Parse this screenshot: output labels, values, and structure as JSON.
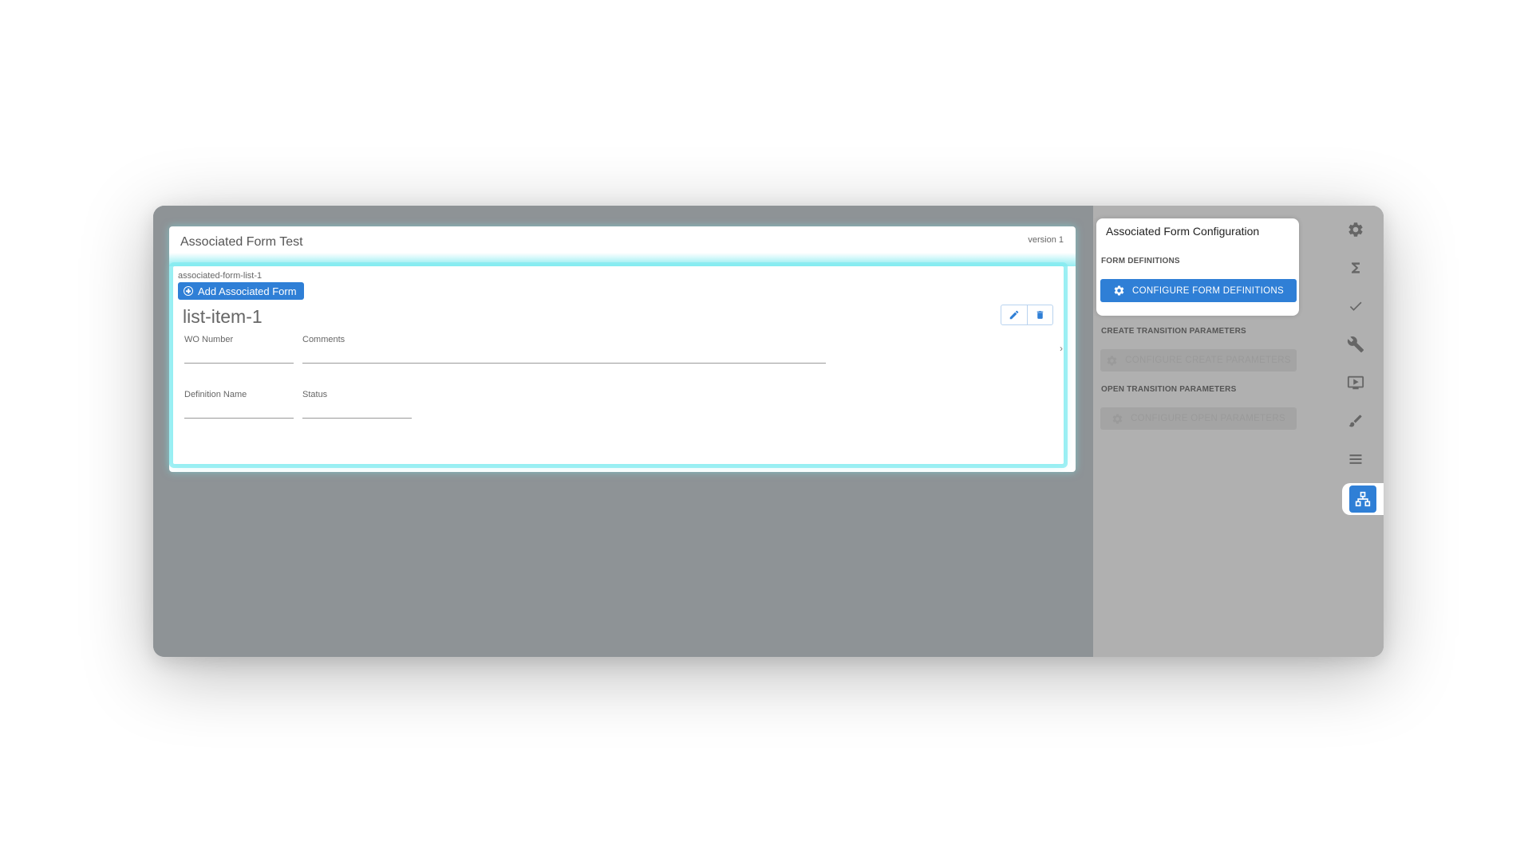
{
  "form": {
    "title": "Associated Form Test",
    "version": "version 1",
    "list": {
      "id": "associated-form-list-1",
      "add_button": "Add Associated Form",
      "item": {
        "title": "list-item-1",
        "fields": [
          {
            "label": "WO Number",
            "value": ""
          },
          {
            "label": "Comments",
            "value": ""
          },
          {
            "label": "Definition Name",
            "value": ""
          },
          {
            "label": "Status",
            "value": ""
          }
        ]
      }
    }
  },
  "config": {
    "title": "Associated Form Configuration",
    "form_definitions_label": "FORM DEFINITIONS",
    "configure_form_definitions": "CONFIGURE FORM DEFINITIONS",
    "create_transition_label": "CREATE TRANSITION PARAMETERS",
    "configure_create": "CONFIGURE CREATE PARAMETERS",
    "open_transition_label": "OPEN TRANSITION PARAMETERS",
    "configure_open": "CONFIGURE OPEN PARAMETERS"
  },
  "toolbar": {
    "tools": [
      "gear-icon",
      "sigma-icon",
      "check-icon",
      "wrench-icon",
      "play-icon",
      "brush-icon",
      "list-icon",
      "hierarchy-icon"
    ],
    "active": "hierarchy-icon"
  },
  "colors": {
    "accent": "#2f7fd6",
    "highlight": "#82ebf0",
    "overlay": "#8e9396",
    "panel": "#b0b0b0"
  }
}
